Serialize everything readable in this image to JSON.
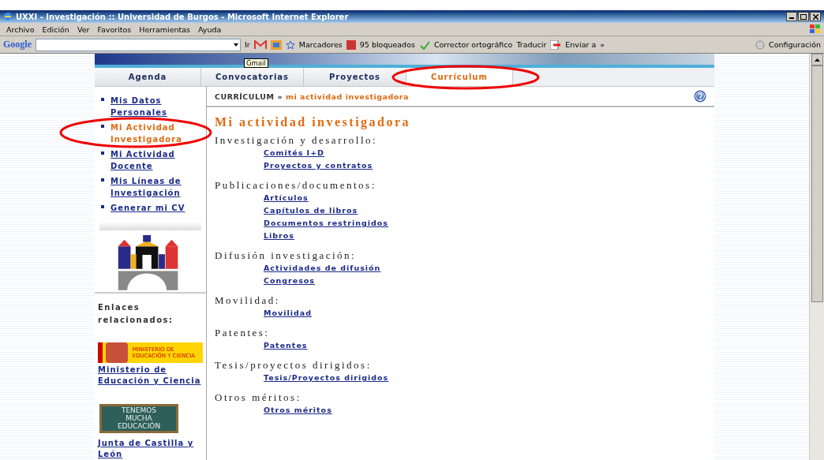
{
  "window": {
    "title": "UXXI - Investigación :: Universidad de Burgos - Microsoft Internet Explorer"
  },
  "menu": [
    "Archivo",
    "Edición",
    "Ver",
    "Favoritos",
    "Herramientas",
    "Ayuda"
  ],
  "toolbar": {
    "brand": "Google",
    "go": "Ir",
    "tooltip": "Gmail",
    "bookmarks": "Marcadores",
    "blocked": "95 bloqueados",
    "spell": "Corrector ortográfico",
    "translate": "Traducir",
    "send": "Enviar a",
    "more": "»",
    "settings": "Configuración"
  },
  "tabs": [
    {
      "label": "Agenda",
      "selected": false
    },
    {
      "label": "Convocatorias",
      "selected": false
    },
    {
      "label": "Proyectos",
      "selected": false
    },
    {
      "label": "Currículum",
      "selected": true
    }
  ],
  "sidebar": {
    "items": [
      {
        "label": "Mis Datos Personales",
        "selected": false
      },
      {
        "label": "Mi Actividad Investigadora",
        "selected": true
      },
      {
        "label": "Mi Actividad Docente",
        "selected": false
      },
      {
        "label": "Mis Líneas de Investigación",
        "selected": false
      },
      {
        "label": "Generar mi CV",
        "selected": false
      }
    ],
    "related_title": "Enlaces relacionados:",
    "related": [
      {
        "kind": "ministry",
        "label": "Ministerio de Educación y Ciencia",
        "logo": "MINISTERIO DE EDUCACIÓN Y CIENCIA"
      },
      {
        "kind": "board",
        "label": "Junta de Castilla y León",
        "logo": "TENEMOS MUCHA EDUCACIÓN"
      }
    ]
  },
  "breadcrumb": {
    "root": "CURRÍCULUM",
    "separator": "»",
    "current": "mi actividad investigadora"
  },
  "heading": "Mi actividad investigadora",
  "sections": [
    {
      "title": "Investigación y desarrollo:",
      "links": [
        "Comités I+D",
        "Proyectos y contratos"
      ]
    },
    {
      "title": "Publicaciones/documentos:",
      "links": [
        "Artículos",
        "Capítulos de libros",
        "Documentos restringidos",
        "Libros"
      ]
    },
    {
      "title": "Difusión investigación:",
      "links": [
        "Actividades de difusión",
        "Congresos"
      ]
    },
    {
      "title": "Movilidad:",
      "links": [
        "Movilidad"
      ]
    },
    {
      "title": "Patentes:",
      "links": [
        "Patentes"
      ]
    },
    {
      "title": "Tesis/proyectos dirigidos:",
      "links": [
        "Tesis/Proyectos dirigidos"
      ]
    },
    {
      "title": "Otros méritos:",
      "links": [
        "Otros méritos"
      ]
    }
  ]
}
